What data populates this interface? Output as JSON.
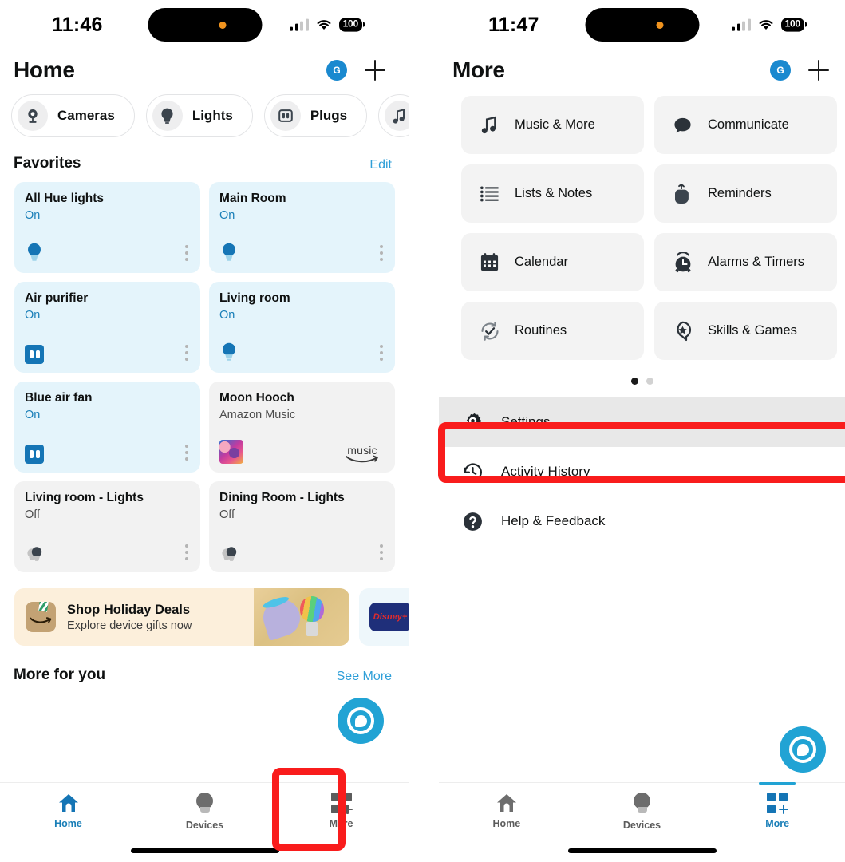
{
  "left_phone": {
    "status_bar": {
      "time": "11:46",
      "battery": "100",
      "wifi_icon": "wifi-icon",
      "signal_icon": "cellular-signal-icon"
    },
    "header": {
      "title": "Home",
      "avatar_initial": "G",
      "add_icon": "plus-icon"
    },
    "chips": [
      {
        "label": "Cameras",
        "icon": "camera-icon"
      },
      {
        "label": "Lights",
        "icon": "lightbulb-icon"
      },
      {
        "label": "Plugs",
        "icon": "plug-icon"
      },
      {
        "label": "",
        "icon": "music-note-icon"
      }
    ],
    "favorites_section": {
      "title": "Favorites",
      "edit_label": "Edit"
    },
    "favorites": [
      {
        "name": "All Hue lights",
        "state": "On",
        "status": "on",
        "icon": "lightbulb-icon"
      },
      {
        "name": "Main Room",
        "state": "On",
        "status": "on",
        "icon": "lightbulb-icon"
      },
      {
        "name": "Air purifier",
        "state": "On",
        "status": "on",
        "icon": "plug-icon"
      },
      {
        "name": "Living room",
        "state": "On",
        "status": "on",
        "icon": "lightbulb-icon"
      },
      {
        "name": "Blue air fan",
        "state": "On",
        "status": "on",
        "icon": "plug-icon"
      },
      {
        "name": "Moon Hooch",
        "state": "Amazon Music",
        "status": "media",
        "icon": "album-art",
        "provider": "music"
      },
      {
        "name": "Living room - Lights",
        "state": "Off",
        "status": "off",
        "icon": "lightbulb-icon"
      },
      {
        "name": "Dining Room - Lights",
        "state": "Off",
        "status": "off",
        "icon": "lightbulb-icon"
      }
    ],
    "promo": {
      "title": "Shop Holiday Deals",
      "subtitle": "Explore device gifts now",
      "icon": "amazon-box-icon",
      "second_card_label": "Disney+"
    },
    "more_for_you": {
      "title": "More for you",
      "link": "See More"
    },
    "assistant_fab": "alexa-button",
    "tabs": [
      {
        "label": "Home",
        "icon": "home-icon",
        "active": true
      },
      {
        "label": "Devices",
        "icon": "lightbulb-icon",
        "active": false
      },
      {
        "label": "More",
        "icon": "grid-plus-icon",
        "active": false
      }
    ]
  },
  "right_phone": {
    "status_bar": {
      "time": "11:47",
      "battery": "100",
      "wifi_icon": "wifi-icon",
      "signal_icon": "cellular-signal-icon"
    },
    "header": {
      "title": "More",
      "avatar_initial": "G",
      "add_icon": "plus-icon"
    },
    "tiles": [
      {
        "label": "Music & More",
        "icon": "music-note-icon"
      },
      {
        "label": "Communicate",
        "icon": "speech-bubble-icon"
      },
      {
        "label": "Lists & Notes",
        "icon": "list-icon"
      },
      {
        "label": "Reminders",
        "icon": "finger-string-icon"
      },
      {
        "label": "Calendar",
        "icon": "calendar-icon"
      },
      {
        "label": "Alarms & Timers",
        "icon": "alarm-clock-icon"
      },
      {
        "label": "Routines",
        "icon": "routines-check-icon"
      },
      {
        "label": "Skills & Games",
        "icon": "skills-star-icon"
      }
    ],
    "pager": {
      "pages": 2,
      "active": 0
    },
    "menu_rows": [
      {
        "label": "Settings",
        "icon": "gear-icon",
        "selected": true
      },
      {
        "label": "Activity History",
        "icon": "history-clock-icon",
        "selected": false
      },
      {
        "label": "Help & Feedback",
        "icon": "question-mark-icon",
        "selected": false
      }
    ],
    "assistant_fab": "alexa-button",
    "tabs": [
      {
        "label": "Home",
        "icon": "home-icon",
        "active": false
      },
      {
        "label": "Devices",
        "icon": "lightbulb-icon",
        "active": false
      },
      {
        "label": "More",
        "icon": "grid-plus-icon",
        "active": true
      }
    ]
  },
  "annotations": {
    "highlight_color": "#f91c1c",
    "boxes": [
      {
        "name": "more-tab-highlight",
        "target": "left_phone.tabs.2"
      },
      {
        "name": "settings-row-highlight",
        "target": "right_phone.menu_rows.0"
      }
    ]
  },
  "colors": {
    "accent_blue": "#1a7fb8",
    "alexa_cyan": "#21a3d4",
    "card_on_bg": "#e4f4fb",
    "card_off_bg": "#f2f2f2",
    "tile_bg": "#f3f3f3",
    "promo_bg": "#fcefdb"
  }
}
